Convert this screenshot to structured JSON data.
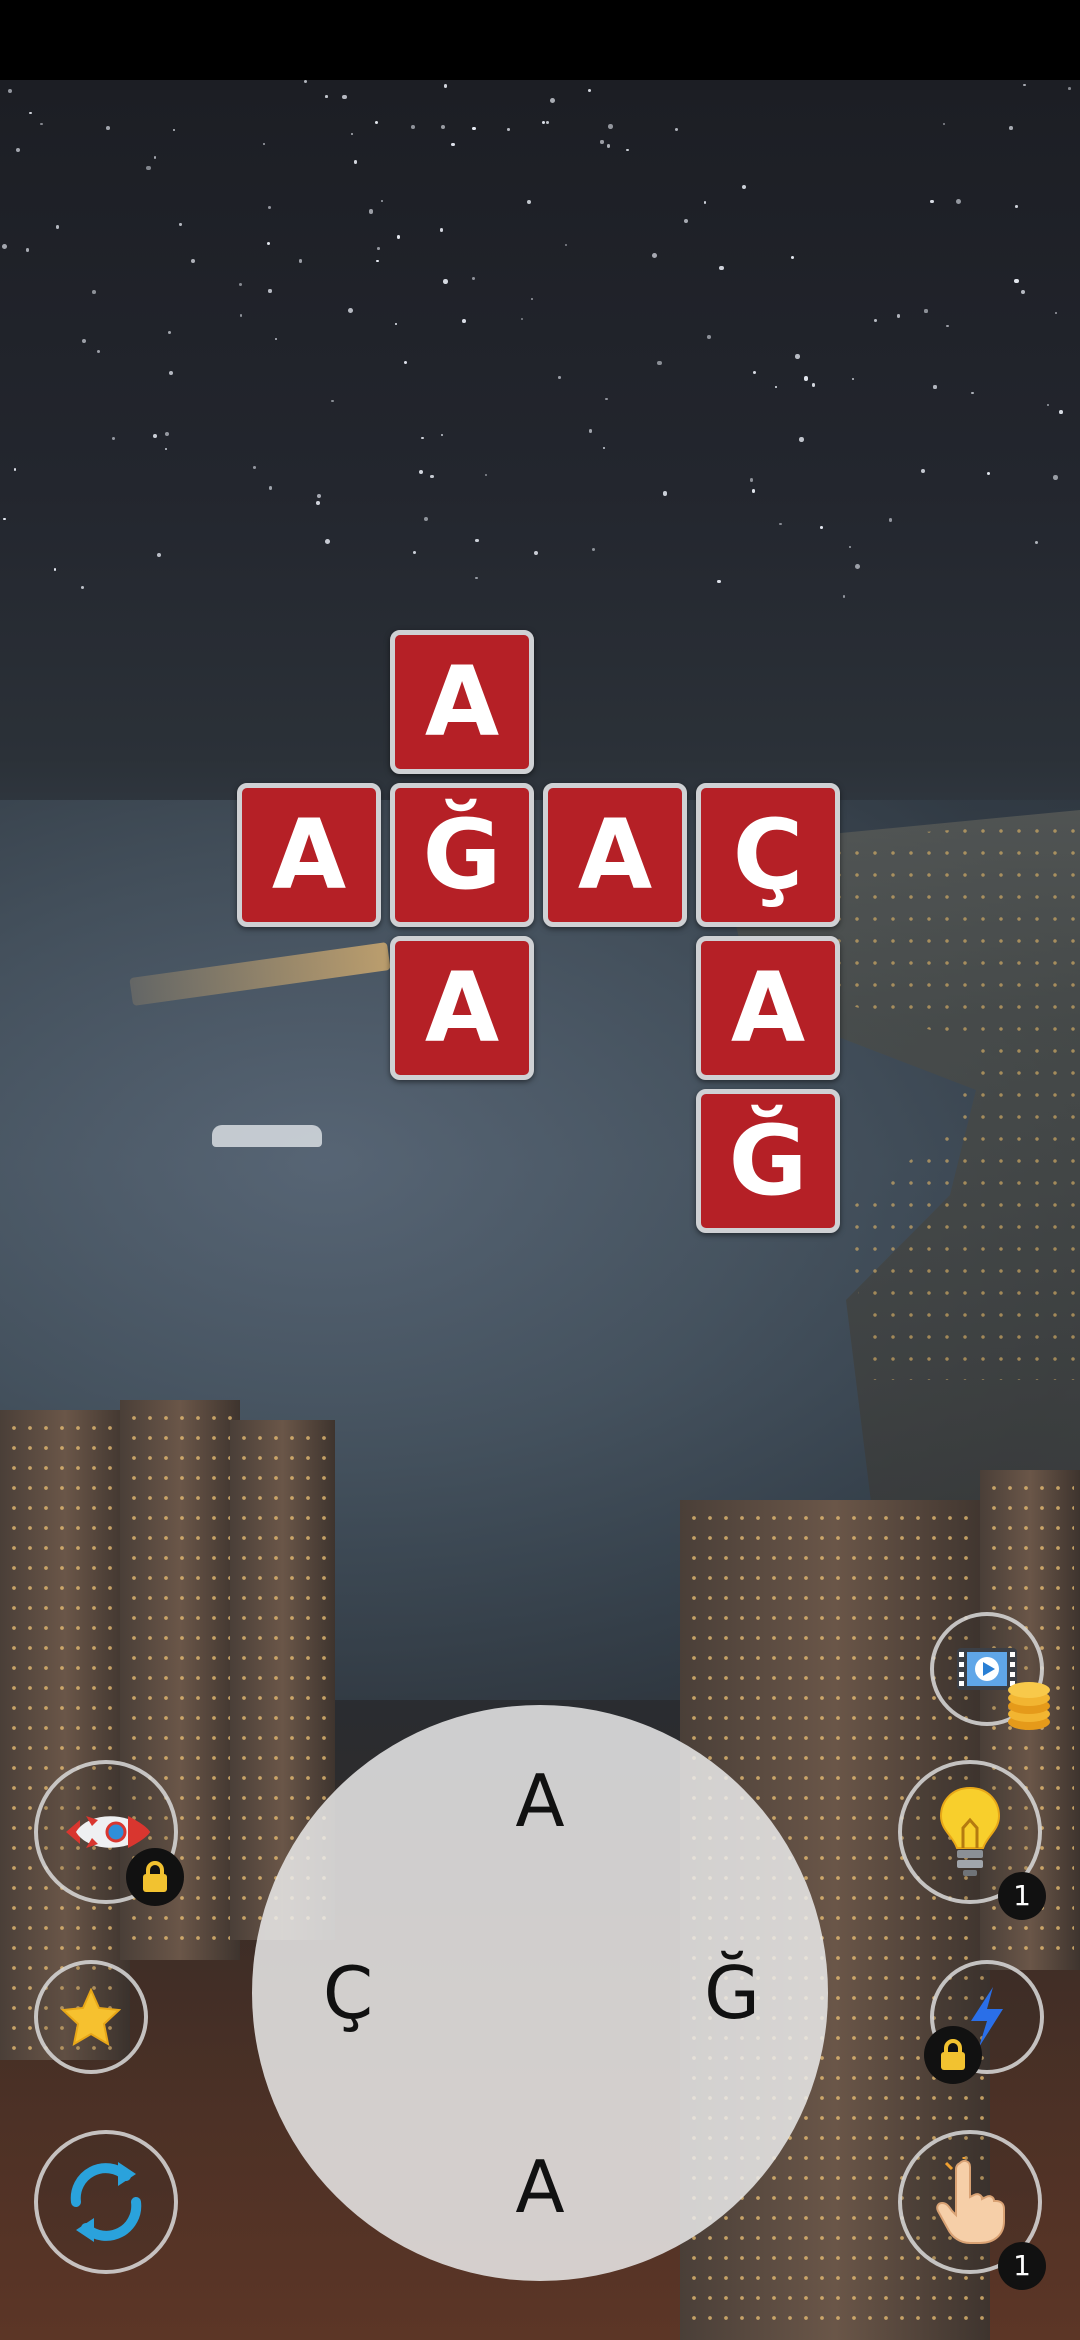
{
  "crossword": {
    "tiles": [
      {
        "id": "r0c1",
        "letter": "A"
      },
      {
        "id": "r1c0",
        "letter": "A"
      },
      {
        "id": "r1c1",
        "letter": "Ğ"
      },
      {
        "id": "r1c2",
        "letter": "A"
      },
      {
        "id": "r1c3",
        "letter": "Ç"
      },
      {
        "id": "r2c1",
        "letter": "A"
      },
      {
        "id": "r2c3",
        "letter": "A"
      },
      {
        "id": "r3c3",
        "letter": "Ğ"
      }
    ],
    "tile_color": "#b52026",
    "tile_border_color": "#cfd1d4"
  },
  "wheel": {
    "letters": {
      "top": "A",
      "left": "Ç",
      "right": "Ğ",
      "bottom": "A"
    }
  },
  "left_buttons": {
    "rocket": {
      "icon": "rocket-icon",
      "locked": true
    },
    "star": {
      "icon": "star-icon"
    },
    "shuffle": {
      "icon": "shuffle-icon"
    }
  },
  "right_buttons": {
    "video_coins": {
      "icon": "video-coins-icon"
    },
    "hint": {
      "icon": "lightbulb-icon",
      "count": "1"
    },
    "lightning": {
      "icon": "lightning-icon",
      "locked": true
    },
    "finger": {
      "icon": "pointing-hand-icon",
      "count": "1"
    }
  }
}
